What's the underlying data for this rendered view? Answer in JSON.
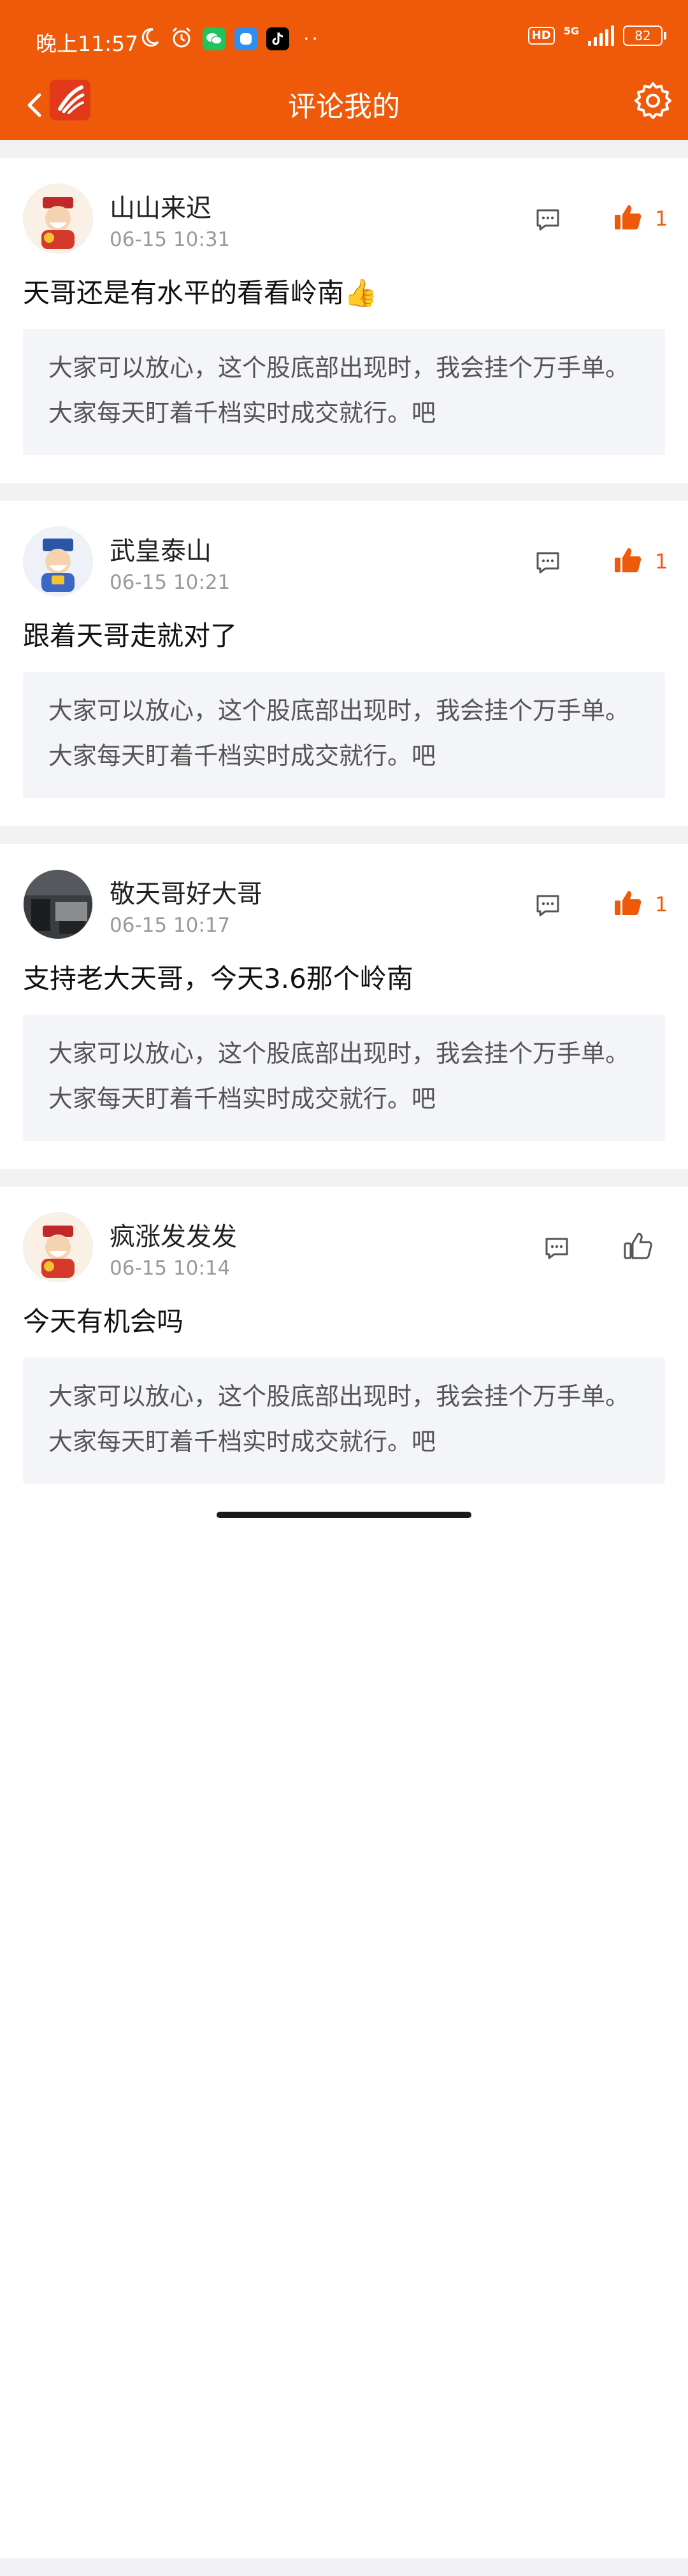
{
  "status_bar": {
    "time": "晚上11:57",
    "network": "5G",
    "hd": "HD",
    "battery": "82",
    "dots": "··"
  },
  "header": {
    "title": "评论我的"
  },
  "quote_text": "大家可以放心，这个股底部出现时，我会挂个万手单。大家每天盯着千档实时成交就行。吧",
  "comments": [
    {
      "username": "山山来迟",
      "time": "06-15 10:31",
      "text": "天哥还是有水平的看看岭南👍",
      "likes": "1",
      "liked": true
    },
    {
      "username": "武皇泰山",
      "time": "06-15 10:21",
      "text": "跟着天哥走就对了",
      "likes": "1",
      "liked": true
    },
    {
      "username": "敬天哥好大哥",
      "time": "06-15 10:17",
      "text": "支持老大天哥，今天3.6那个岭南",
      "likes": "1",
      "liked": true
    },
    {
      "username": "疯涨发发发",
      "time": "06-15 10:14",
      "text": "今天有机会吗",
      "likes": "",
      "liked": false
    }
  ],
  "colors": {
    "accent": "#ee5a0a",
    "background": "#f2f2f4",
    "quote_bg": "#f4f5f8"
  }
}
